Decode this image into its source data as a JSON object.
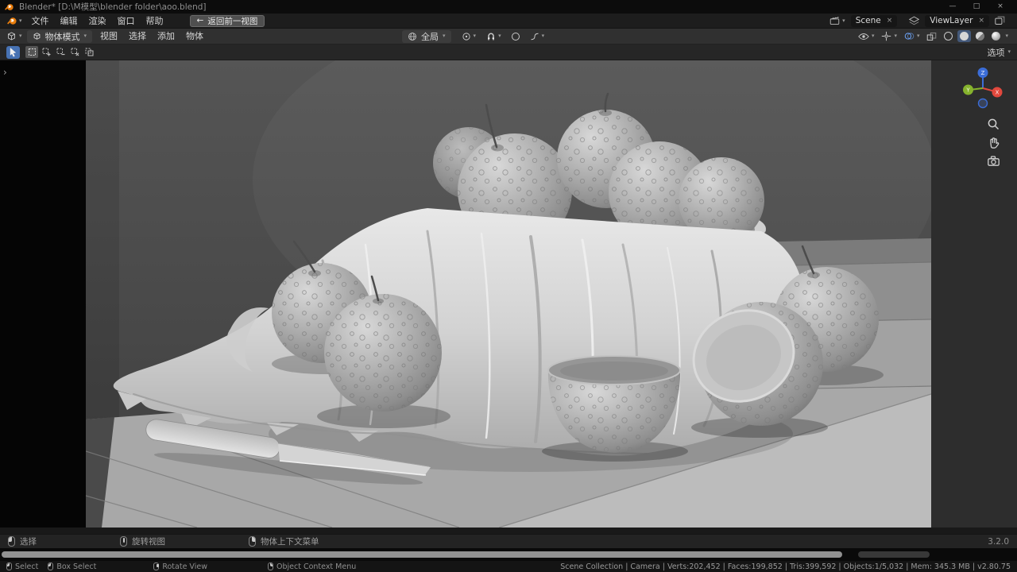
{
  "icons": {
    "caret": "▾",
    "close_x": "×",
    "flyout": "›",
    "back_arrow": "←",
    "win_min": "—",
    "win_max": "□",
    "win_close": "×"
  },
  "window": {
    "title": "Blender* [D:\\M模型\\blender folder\\aoo.blend]"
  },
  "topbar": {
    "menus": [
      "文件",
      "编辑",
      "渲染",
      "窗口",
      "帮助"
    ],
    "back_label": "返回前一视图",
    "scene_label": "Scene",
    "view_layer_label": "ViewLayer"
  },
  "vp_header": {
    "mode": "物体模式",
    "menus": [
      "视图",
      "选择",
      "添加",
      "物体"
    ],
    "orientation": "全局"
  },
  "tool_settings": {
    "options": "选项"
  },
  "status_bar": {
    "hints": [
      {
        "label": "选择"
      },
      {
        "label": "旋转视图"
      },
      {
        "label": "物体上下文菜单"
      }
    ],
    "version": "3.2.0"
  },
  "bottom_bar": {
    "hints": [
      "Select",
      "Box Select",
      "Rotate View",
      "Object Context Menu"
    ],
    "stats": "Scene Collection | Camera | Verts:202,452 | Faces:199,852 | Tris:399,592 | Objects:1/5,032 | Mem: 345.3 MB | v2.80.75"
  },
  "colors": {
    "accent": "#4772b3",
    "logo_orange": "#e87d0d",
    "axis_x": "#e2483d",
    "axis_y": "#86b32d",
    "axis_z": "#3b6dd8"
  }
}
